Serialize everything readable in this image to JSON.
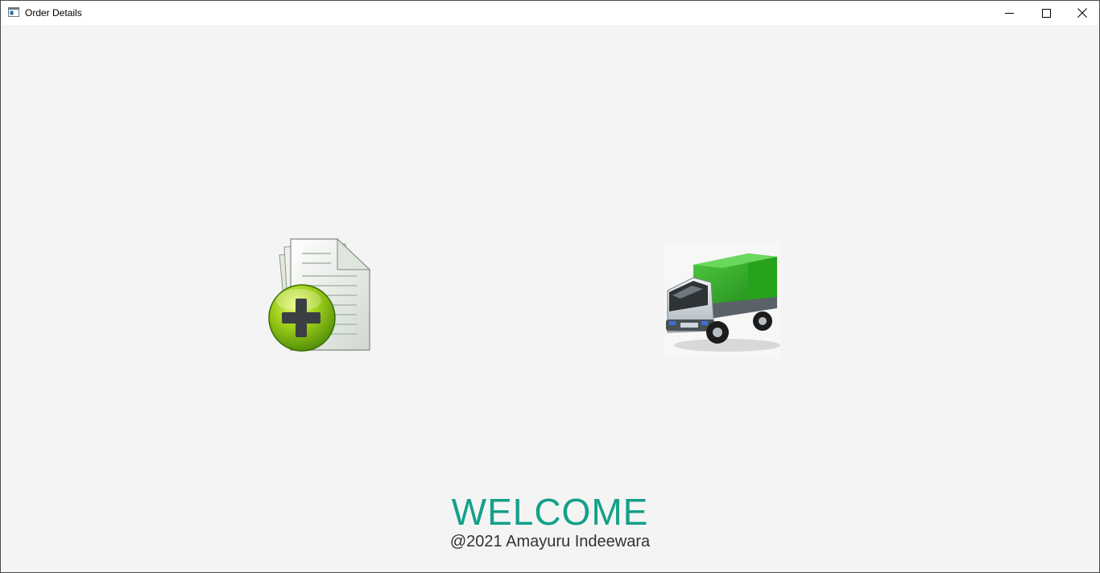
{
  "window": {
    "title": "Order Details"
  },
  "main": {
    "heading": "WELCOME",
    "copyright": "@2021 Amayuru Indeewara",
    "heading_color": "#14a08a",
    "buttons": [
      {
        "name": "add-order",
        "icon": "document-add-icon"
      },
      {
        "name": "delivery",
        "icon": "truck-icon"
      }
    ]
  }
}
